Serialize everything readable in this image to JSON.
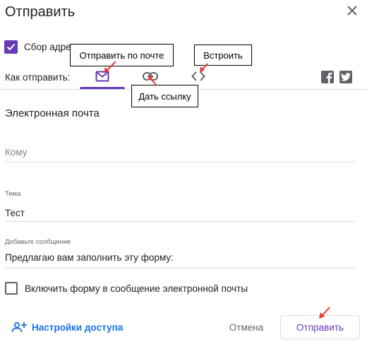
{
  "dialog": {
    "title": "Отправить"
  },
  "collect": {
    "label": "Сбор адре",
    "checked": true
  },
  "how_to_send": {
    "label": "Как отправить:",
    "tabs": [
      {
        "name": "email",
        "icon": "mail-icon",
        "selected": true
      },
      {
        "name": "link",
        "icon": "link-icon",
        "selected": false
      },
      {
        "name": "embed",
        "icon": "code-icon",
        "selected": false
      }
    ],
    "social": [
      "facebook-icon",
      "twitter-icon"
    ]
  },
  "callouts": {
    "mail": "Отправить по почте",
    "embed": "Встроить",
    "link": "Дать ссылку"
  },
  "email_form": {
    "section_title": "Электронная почта",
    "to_placeholder": "Кому",
    "subject_label": "Тема",
    "subject_value": "Тест",
    "message_label": "Добавьте сообщение",
    "message_value": "Предлагаю вам заполнить эту форму:",
    "include_label": "Включить форму в сообщение электронной почты",
    "include_checked": false
  },
  "footer": {
    "access_label": "Настройки доступа",
    "cancel_label": "Отмена",
    "send_label": "Отправить"
  },
  "colors": {
    "accent": "#673ab7",
    "link": "#1a73e8",
    "annotation_arrow": "#e53935"
  }
}
